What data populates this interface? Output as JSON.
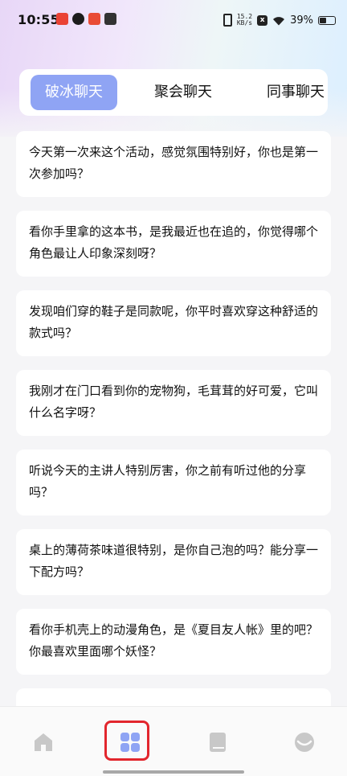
{
  "status_bar": {
    "time": "10:55",
    "net_speed_value": "15.2",
    "net_speed_unit": "KB/s",
    "battery": "39%"
  },
  "tabs": [
    {
      "label": "破冰聊天",
      "selected": true
    },
    {
      "label": "聚会聊天",
      "selected": false
    },
    {
      "label": "同事聊天",
      "selected": false
    }
  ],
  "cards": [
    {
      "text": "今天第一次来这个活动，感觉氛围特别好，你也是第一次参加吗？"
    },
    {
      "text": "看你手里拿的这本书，是我最近也在追的，你觉得哪个角色最让人印象深刻呀？"
    },
    {
      "text": "发现咱们穿的鞋子是同款呢，你平时喜欢穿这种舒适的款式吗？"
    },
    {
      "text": "我刚才在门口看到你的宠物狗，毛茸茸的好可爱，它叫什么名字呀？"
    },
    {
      "text": "听说今天的主讲人特别厉害，你之前有听过他的分享吗？"
    },
    {
      "text": "桌上的薄荷茶味道很特别，是你自己泡的吗？能分享一下配方吗？"
    },
    {
      "text": "看你手机壳上的动漫角色，是《夏目友人帐》里的吧？你最喜欢里面哪个妖怪？"
    },
    {
      "text": ""
    }
  ],
  "bottom_nav": [
    {
      "icon": "home-icon",
      "active": false
    },
    {
      "icon": "grid-icon",
      "active": true
    },
    {
      "icon": "book-icon",
      "active": false
    },
    {
      "icon": "profile-icon",
      "active": false
    }
  ],
  "colors": {
    "accent": "#8fa4f4",
    "highlight": "#e2262d",
    "inactive_icon": "#c8c8c8"
  }
}
